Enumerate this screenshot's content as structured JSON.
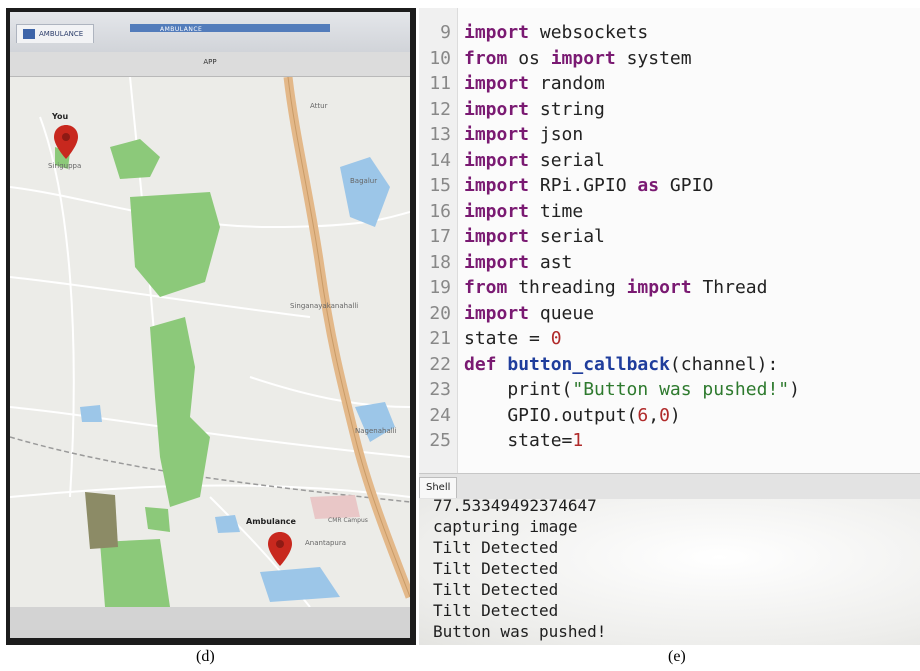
{
  "panel_d": {
    "caption": "(d)",
    "app_tab_label": "AMBULANCE",
    "app_title": "AMBULANCE",
    "toolbar_label": "APP",
    "markers": {
      "you_label": "You",
      "ambulance_label": "Ambulance"
    },
    "map_places": [
      "Siriguppa",
      "Singanayakanahalli",
      "Nagenahalli",
      "CMR Campus",
      "Anantapura",
      "Attur",
      "Bagalur"
    ]
  },
  "panel_e": {
    "caption": "(e)",
    "editor": {
      "lines": [
        {
          "n": "9",
          "code": "import websockets"
        },
        {
          "n": "10",
          "code": "from os import system"
        },
        {
          "n": "11",
          "code": "import random"
        },
        {
          "n": "12",
          "code": "import string"
        },
        {
          "n": "13",
          "code": "import json"
        },
        {
          "n": "14",
          "code": "import serial"
        },
        {
          "n": "15",
          "code": "import RPi.GPIO as GPIO"
        },
        {
          "n": "16",
          "code": "import time"
        },
        {
          "n": "17",
          "code": "import serial"
        },
        {
          "n": "18",
          "code": "import ast"
        },
        {
          "n": "19",
          "code": "from threading import Thread"
        },
        {
          "n": "20",
          "code": "import queue"
        },
        {
          "n": "21",
          "code": "state = 0"
        },
        {
          "n": "22",
          "code": "def button_callback(channel):"
        },
        {
          "n": "23",
          "code": "    print(\"Button was pushed!\")"
        },
        {
          "n": "24",
          "code": "    GPIO.output(6,0)"
        },
        {
          "n": "25",
          "code": "    state=1"
        }
      ]
    },
    "shell": {
      "tab_label": "Shell",
      "lines": [
        "77.53349492374647",
        "capturing image",
        "Tilt Detected",
        "Tilt Detected",
        "Tilt Detected",
        "Tilt Detected",
        "Button was pushed!"
      ]
    }
  },
  "colors": {
    "keyword": "#7a1a72",
    "function_name": "#1f3d9c",
    "string": "#2e7a2e",
    "number": "#b02a2a",
    "map_pin": "#c8281e",
    "map_road": "#e3b889",
    "map_park": "#8cc97a",
    "map_water": "#9cc6e8"
  }
}
